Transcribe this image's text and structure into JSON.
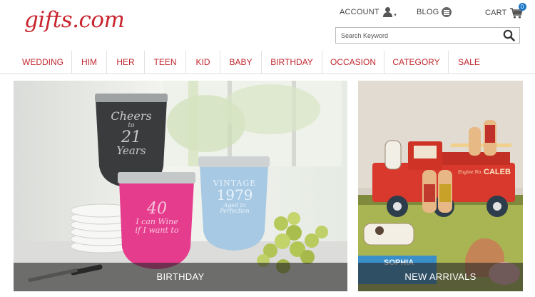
{
  "logo": {
    "text": "gifts.com"
  },
  "header": {
    "account_label": "ACCOUNT",
    "blog_label": "BLOG",
    "cart_label": "CART",
    "cart_count": "0"
  },
  "search": {
    "placeholder": "Search Keyword"
  },
  "nav": {
    "items": [
      {
        "label": "WEDDING"
      },
      {
        "label": "HIM"
      },
      {
        "label": "HER"
      },
      {
        "label": "TEEN"
      },
      {
        "label": "KID"
      },
      {
        "label": "BABY"
      },
      {
        "label": "BIRTHDAY"
      },
      {
        "label": "OCCASION"
      },
      {
        "label": "CATEGORY"
      },
      {
        "label": "SALE"
      }
    ]
  },
  "banners": {
    "left": {
      "caption": "BIRTHDAY",
      "tumbler_black": [
        "Cheers",
        "to",
        "21",
        "Years"
      ],
      "tumbler_pink": [
        "40",
        "I can Wine",
        "if I want to"
      ],
      "tumbler_blue": [
        "VINTAGE",
        "1979",
        "Aged to",
        "Perfection"
      ]
    },
    "right": {
      "caption": "NEW ARRIVALS",
      "truck_text": "Engine No. 1",
      "truck_name": "CALEB",
      "train_name": "SOPHIA"
    }
  },
  "colors": {
    "brand_red": "#c8252f",
    "nav_red": "#c0282f",
    "badge_blue": "#1a78c8"
  }
}
